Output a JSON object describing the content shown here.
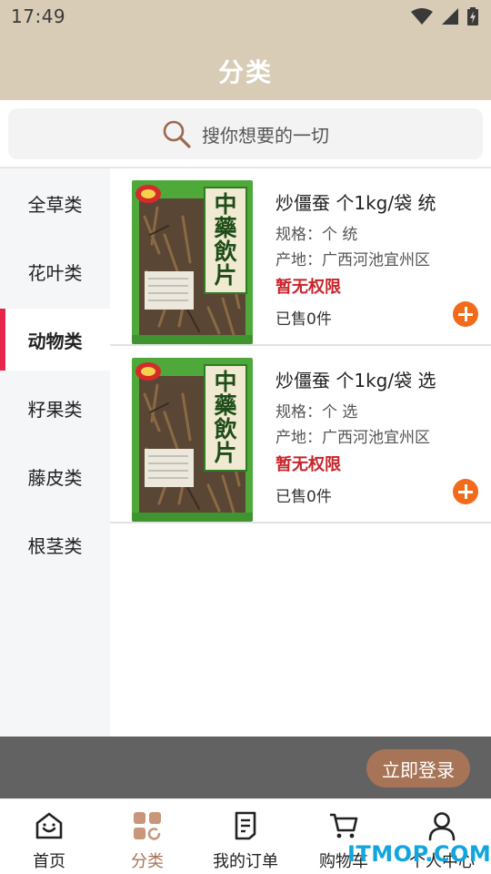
{
  "status_bar": {
    "time": "17:49"
  },
  "header": {
    "title": "分类"
  },
  "search": {
    "placeholder": "搜你想要的一切"
  },
  "sidebar": {
    "active_index": 2,
    "items": [
      {
        "label": "全草类"
      },
      {
        "label": "花叶类"
      },
      {
        "label": "动物类"
      },
      {
        "label": "籽果类"
      },
      {
        "label": "藤皮类"
      },
      {
        "label": "根茎类"
      }
    ]
  },
  "products": [
    {
      "name": "炒僵蚕 个1kg/袋 统",
      "spec": "规格：个 统",
      "origin": "产地：广西河池宜州区",
      "price": "暂无权限",
      "sold": "已售0件",
      "image_label": "中藥飲片"
    },
    {
      "name": "炒僵蚕 个1kg/袋 选",
      "spec": "规格：个 选",
      "origin": "产地：广西河池宜州区",
      "price": "暂无权限",
      "sold": "已售0件",
      "image_label": "中藥飲片"
    }
  ],
  "login_banner": {
    "button_label": "立即登录"
  },
  "tabbar": {
    "active_index": 1,
    "items": [
      {
        "label": "首页",
        "icon": "home-icon"
      },
      {
        "label": "分类",
        "icon": "category-icon"
      },
      {
        "label": "我的订单",
        "icon": "order-icon"
      },
      {
        "label": "购物车",
        "icon": "cart-icon"
      },
      {
        "label": "个人中心",
        "icon": "user-icon"
      }
    ]
  },
  "watermark": {
    "text": "ITMOP.COM"
  },
  "colors": {
    "header_bg": "#d8ccb6",
    "accent": "#a77457",
    "sidebar_active_bar": "#e8254a",
    "price_red": "#c8242b",
    "add_button": "#f26a1c"
  }
}
